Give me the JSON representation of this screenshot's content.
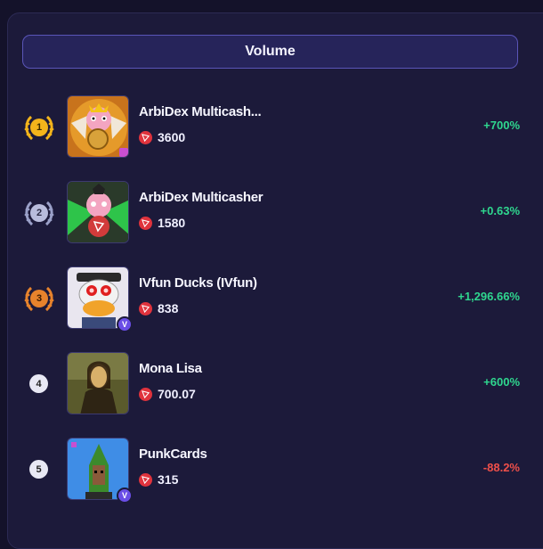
{
  "header": {
    "label": "Volume"
  },
  "colors": {
    "positive": "#2fd78f",
    "negative": "#f0504a",
    "gold": "#f3b41b",
    "silver": "#9aa0c8",
    "bronze": "#e7832c"
  },
  "rows": [
    {
      "rank": "1",
      "name": "ArbiDex Multicash...",
      "volume": "3600",
      "change": "+700%",
      "icon": "cat-with-wings-image",
      "verified": false
    },
    {
      "rank": "2",
      "name": "ArbiDex Multicasher",
      "volume": "1580",
      "change": "+0.63%",
      "icon": "cat-with-wings-image",
      "verified": false
    },
    {
      "rank": "3",
      "name": "IVfun Ducks (IVfun)",
      "volume": "838",
      "change": "+1,296.66%",
      "icon": "duck-image",
      "verified": true,
      "verified_badge": "V"
    },
    {
      "rank": "4",
      "name": "Mona Lisa",
      "volume": "700.07",
      "change": "+600%",
      "icon": "mona-lisa-image",
      "verified": false
    },
    {
      "rank": "5",
      "name": "PunkCards",
      "volume": "315",
      "change": "-88.2%",
      "icon": "pixel-punk-image",
      "verified": true,
      "verified_badge": "V"
    }
  ]
}
